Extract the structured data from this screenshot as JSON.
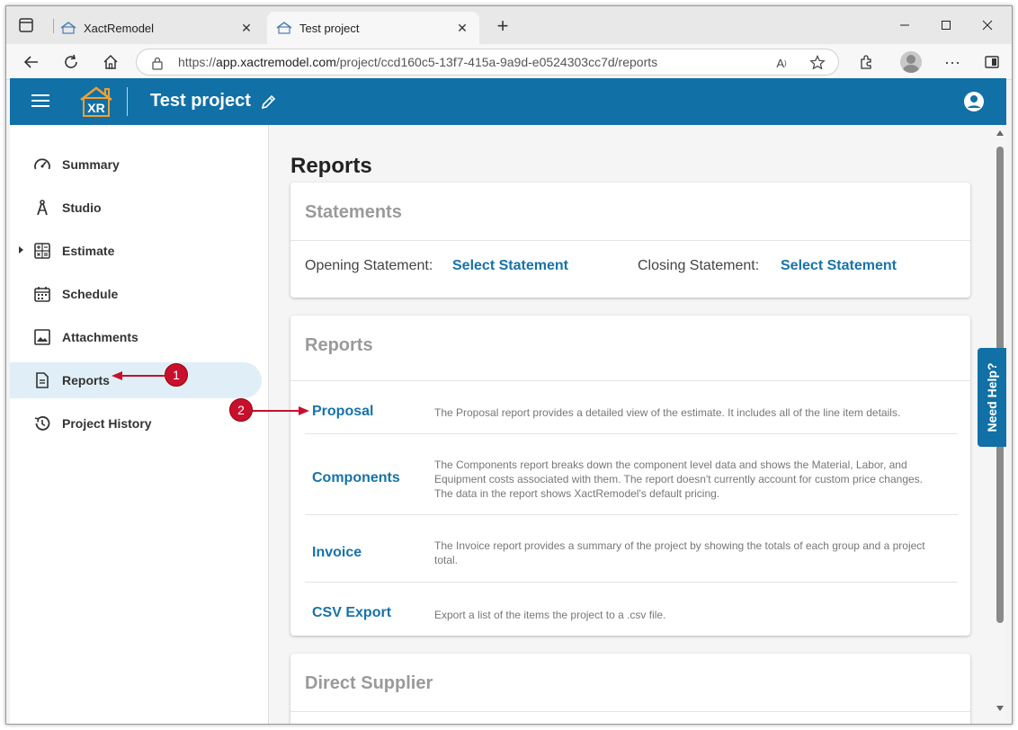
{
  "browser": {
    "tabs": [
      {
        "title": "XactRemodel",
        "active": false
      },
      {
        "title": "Test project",
        "active": true
      }
    ],
    "url_prefix": "https://",
    "url_host": "app.xactremodel.com",
    "url_path": "/project/ccd160c5-13f7-415a-9a9d-e0524303cc7d/reports"
  },
  "header": {
    "logo_text": "XR",
    "project_title": "Test project"
  },
  "sidebar": {
    "items": [
      {
        "label": "Summary",
        "icon": "speedometer-icon"
      },
      {
        "label": "Studio",
        "icon": "compass-icon"
      },
      {
        "label": "Estimate",
        "icon": "calculator-icon"
      },
      {
        "label": "Schedule",
        "icon": "calendar-icon"
      },
      {
        "label": "Attachments",
        "icon": "image-icon"
      },
      {
        "label": "Reports",
        "icon": "document-icon",
        "selected": true
      },
      {
        "label": "Project History",
        "icon": "history-icon"
      }
    ]
  },
  "main": {
    "heading": "Reports",
    "statements": {
      "title": "Statements",
      "opening_label": "Opening Statement:",
      "opening_link": "Select Statement",
      "closing_label": "Closing Statement:",
      "closing_link": "Select Statement"
    },
    "reports": {
      "title": "Reports",
      "rows": [
        {
          "name": "Proposal",
          "description": "The Proposal report provides a detailed view of the estimate. It includes all of the line item details."
        },
        {
          "name": "Components",
          "description": "The Components report breaks down the component level data and shows the Material, Labor, and Equipment costs associated with them. The report doesn't currently account for custom price changes. The data in the report shows XactRemodel's default pricing."
        },
        {
          "name": "Invoice",
          "description": "The Invoice report provides a summary of the project by showing the totals of each group and a project total."
        },
        {
          "name": "CSV Export",
          "description": "Export a list of the items the project to a .csv file."
        }
      ]
    },
    "direct_supplier": {
      "title": "Direct Supplier"
    }
  },
  "need_help": "Need Help?",
  "annotations": [
    "1",
    "2"
  ],
  "colors": {
    "brand": "#1170a6",
    "link": "#1773a8",
    "callout": "#c8102e",
    "logo_accent": "#f0a030"
  }
}
